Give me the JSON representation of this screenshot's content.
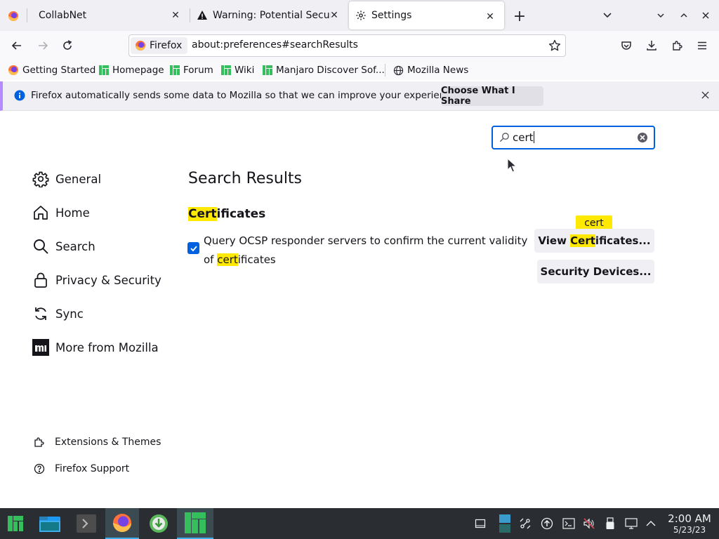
{
  "window": {
    "title": "Settings"
  },
  "tabs": [
    {
      "label": "CollabNet",
      "icon": "firefox-icon"
    },
    {
      "label": "Warning: Potential Security Risk Ahead",
      "icon": "warning-icon"
    },
    {
      "label": "Settings",
      "icon": "gear-icon",
      "active": true
    }
  ],
  "navbar": {
    "identity_label": "Firefox",
    "url": "about:preferences#searchResults"
  },
  "bookmarks": [
    {
      "label": "Getting Started",
      "icon": "firefox-icon"
    },
    {
      "label": "Homepage",
      "icon": "manjaro-icon"
    },
    {
      "label": "Forum",
      "icon": "manjaro-icon"
    },
    {
      "label": "Wiki",
      "icon": "manjaro-icon"
    },
    {
      "label": "Manjaro Discover Sof...",
      "icon": "manjaro-icon"
    },
    {
      "label": "Mozilla News",
      "icon": "globe-icon"
    }
  ],
  "notification": {
    "text": "Firefox automatically sends some data to Mozilla so that we can improve your experience.",
    "button": "Choose What I Share"
  },
  "search": {
    "value": "cert"
  },
  "sidebar": {
    "items": [
      {
        "label": "General",
        "icon": "gear-icon"
      },
      {
        "label": "Home",
        "icon": "home-icon"
      },
      {
        "label": "Search",
        "icon": "search-icon"
      },
      {
        "label": "Privacy & Security",
        "icon": "lock-icon"
      },
      {
        "label": "Sync",
        "icon": "sync-icon"
      },
      {
        "label": "More from Mozilla",
        "icon": "mozilla-icon"
      }
    ],
    "footer": [
      {
        "label": "Extensions & Themes",
        "icon": "puzzle-icon"
      },
      {
        "label": "Firefox Support",
        "icon": "help-icon"
      }
    ]
  },
  "main": {
    "heading": "Search Results",
    "section": {
      "highlight": "Cert",
      "rest": "ificates"
    },
    "checkbox": {
      "checked": true,
      "text_part1": "Query OCSP responder servers to confirm the current validity of ",
      "highlight": "cert",
      "text_part2": "ificates"
    },
    "tooltip": "cert",
    "buttons": {
      "view_prefix": "View ",
      "view_highlight": "Cert",
      "view_suffix": "ificates...",
      "security_devices": "Security Devices..."
    }
  },
  "taskbar": {
    "time": "2:00 AM",
    "date": "5/23/23"
  },
  "colors": {
    "accent": "#0061e0",
    "highlight": "#ffe900",
    "taskbar": "#2a2e32",
    "manjaro_green": "#35bf5c"
  }
}
